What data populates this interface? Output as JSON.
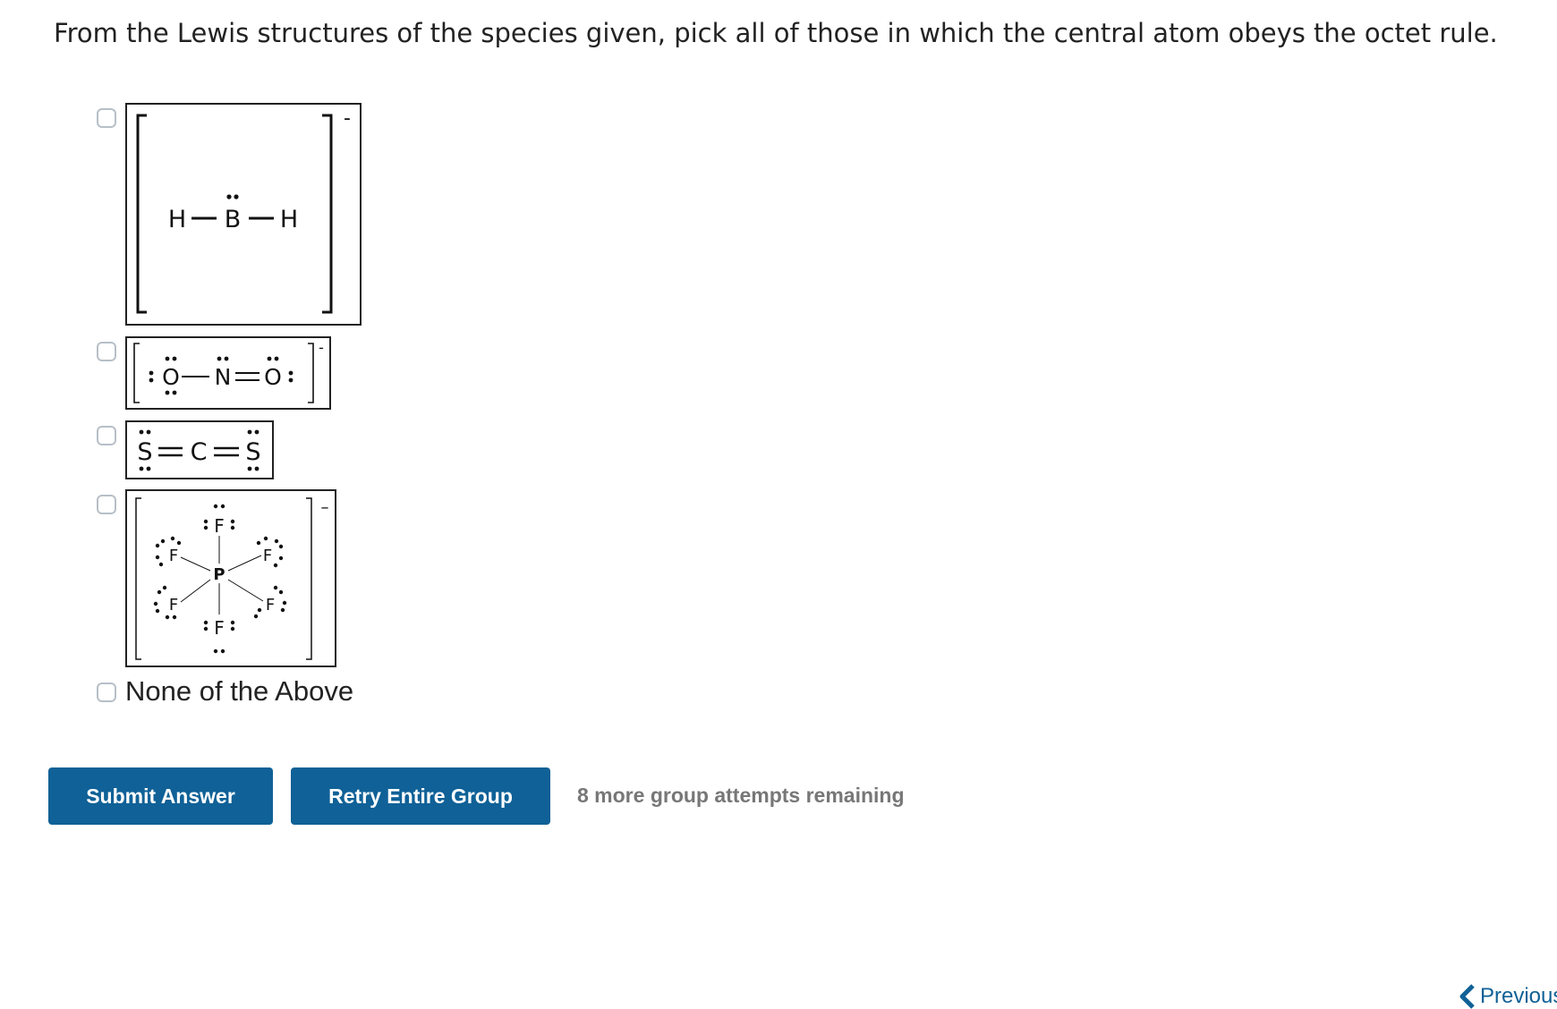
{
  "question": "From the Lewis structures of the species given, pick all of those in which the central atom obeys the octet rule.",
  "options": [
    {
      "id": "bh2",
      "atoms": {
        "left": "H",
        "center": "B",
        "right": "H"
      },
      "charge": "-"
    },
    {
      "id": "no2",
      "atoms": {
        "left": "O",
        "center": "N",
        "right": "O"
      },
      "charge": "-"
    },
    {
      "id": "cs2",
      "atoms": {
        "left": "S",
        "center": "C",
        "right": "S"
      }
    },
    {
      "id": "pf6",
      "atoms": {
        "center": "P",
        "ligand": "F"
      },
      "charge": "–"
    },
    {
      "id": "none",
      "label": "None of the Above"
    }
  ],
  "buttons": {
    "submit": "Submit Answer",
    "retry": "Retry Entire Group"
  },
  "attempts_text": "8 more group attempts remaining",
  "nav": {
    "previous": "Previous"
  },
  "colors": {
    "button_bg": "#0f6197",
    "checkbox_border": "#b7bfc7",
    "attempts_text": "#777777"
  }
}
